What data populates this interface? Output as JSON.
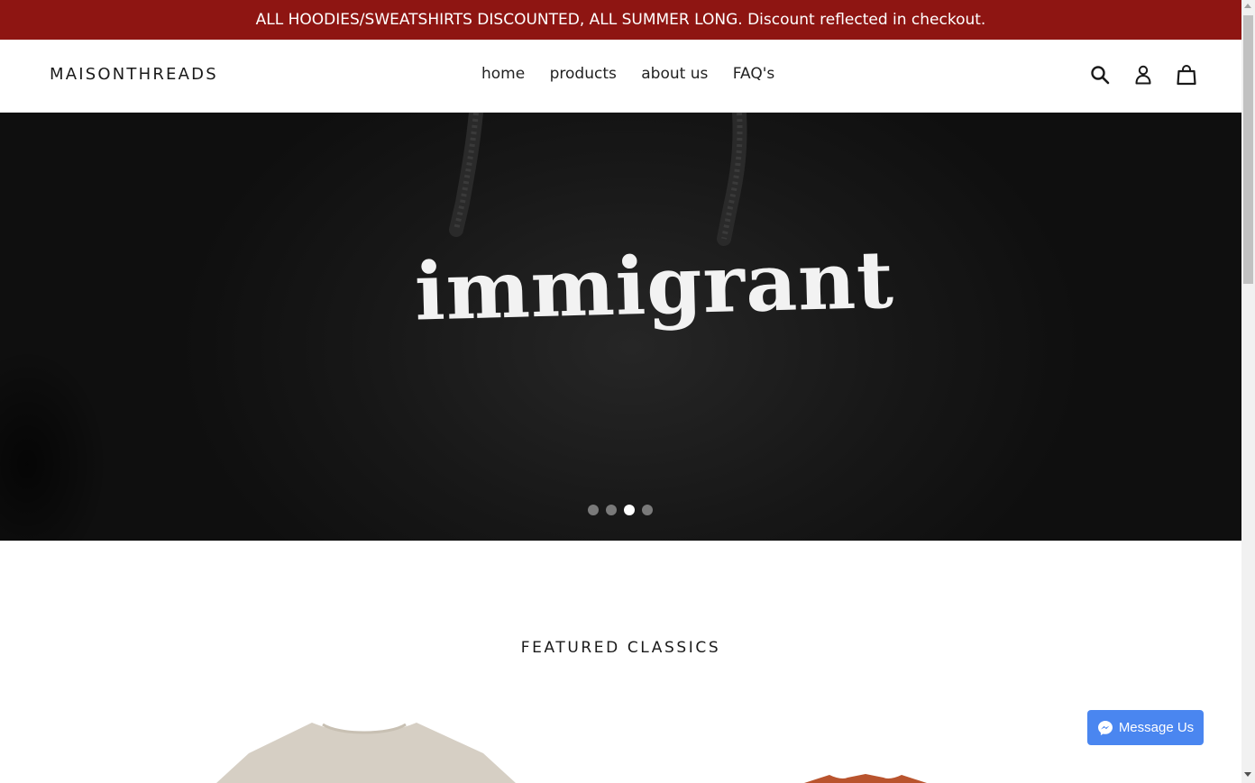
{
  "announcement": {
    "text": "ALL HOODIES/SWEATSHIRTS DISCOUNTED, ALL SUMMER LONG. Discount reflected in checkout."
  },
  "header": {
    "logo": "MAISONTHREADS",
    "nav": [
      {
        "label": "home"
      },
      {
        "label": "products"
      },
      {
        "label": "about us"
      },
      {
        "label": "FAQ's"
      }
    ],
    "icons": [
      "search-icon",
      "account-icon",
      "cart-icon"
    ]
  },
  "hero": {
    "word": "immigrant",
    "slides_total": 4,
    "active_slide": 3
  },
  "featured": {
    "title": "FEATURED CLASSICS"
  },
  "messenger": {
    "label": "Message Us"
  },
  "colors": {
    "announcement_bg": "#8e1512",
    "messenger_bg": "#4a86f0",
    "product1_color": "#d6cfc4",
    "product2_color": "#b9542e"
  }
}
